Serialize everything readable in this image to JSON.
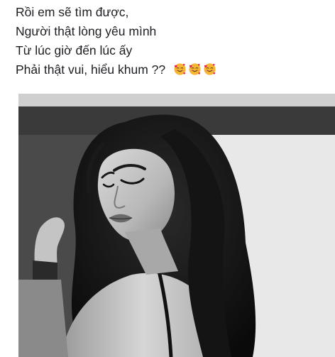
{
  "post": {
    "lines": [
      "Rồi em sẽ tìm được,",
      "Người thật lòng yêu mình",
      "Từ lúc giờ đến lúc ấy",
      "Phải thật vui, hiểu khum ??"
    ],
    "emojis": [
      "smiling-face-with-hearts-icon",
      "smiling-face-with-hearts-icon",
      "smiling-face-with-hearts-icon"
    ]
  },
  "photo": {
    "style": "black-and-white"
  },
  "colors": {
    "text": "#1c1e21",
    "background": "#ffffff",
    "emoji_face": "#f7b733",
    "emoji_heart": "#e0245e"
  }
}
